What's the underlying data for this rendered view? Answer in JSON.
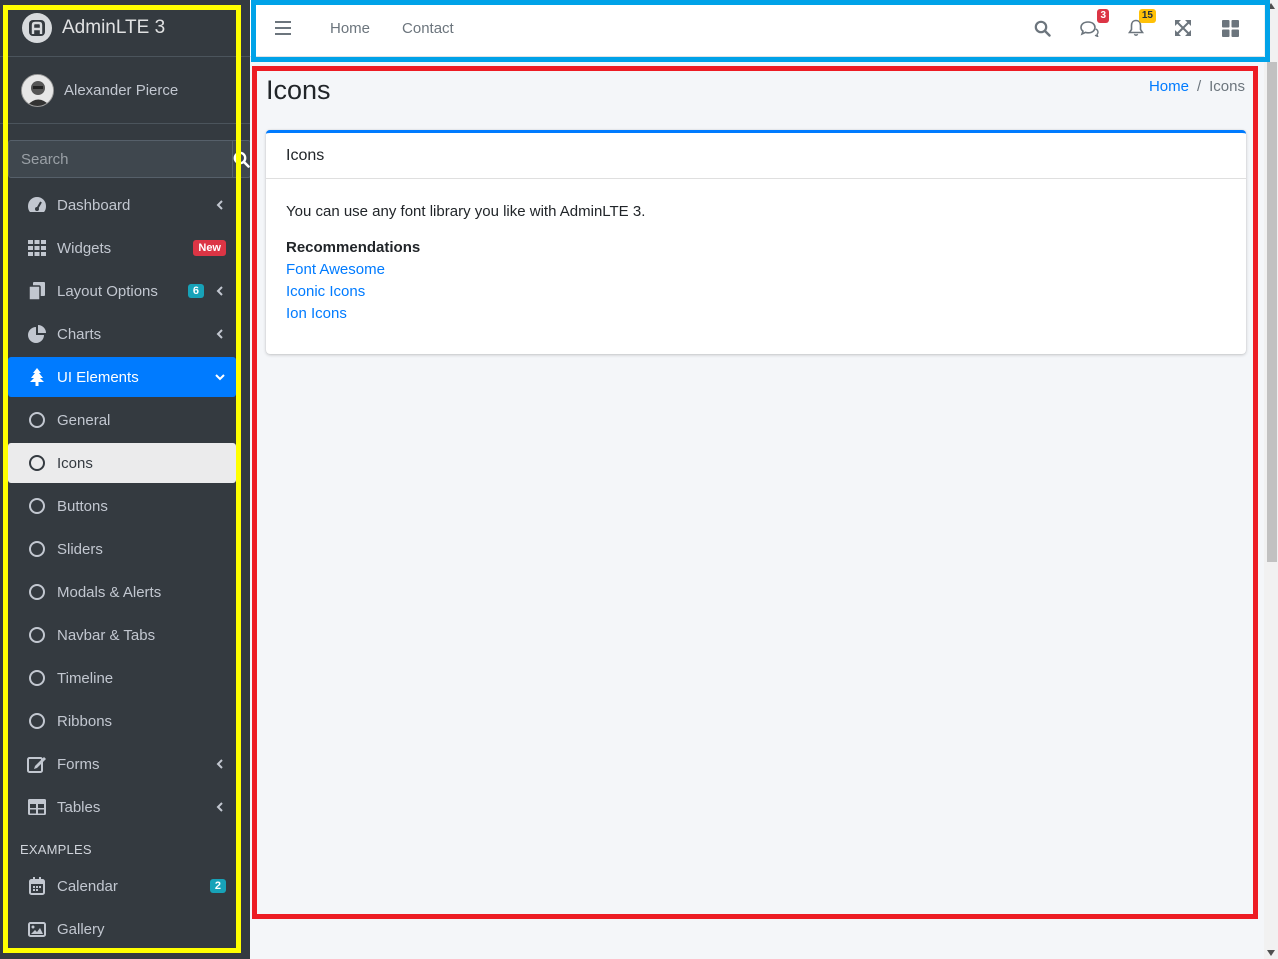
{
  "brand": {
    "name": "AdminLTE 3"
  },
  "user": {
    "name": "Alexander Pierce"
  },
  "search": {
    "placeholder": "Search"
  },
  "sidebar": {
    "items": [
      {
        "label": "Dashboard",
        "icon": "tachometer-icon"
      },
      {
        "label": "Widgets",
        "icon": "th-grid-icon",
        "badge": "New"
      },
      {
        "label": "Layout Options",
        "icon": "copy-icon",
        "badge": "6"
      },
      {
        "label": "Charts",
        "icon": "pie-chart-icon"
      },
      {
        "label": "UI Elements",
        "icon": "tree-icon"
      },
      {
        "label": "General",
        "icon": "circle-icon"
      },
      {
        "label": "Icons",
        "icon": "circle-icon"
      },
      {
        "label": "Buttons",
        "icon": "circle-icon"
      },
      {
        "label": "Sliders",
        "icon": "circle-icon"
      },
      {
        "label": "Modals & Alerts",
        "icon": "circle-icon"
      },
      {
        "label": "Navbar & Tabs",
        "icon": "circle-icon"
      },
      {
        "label": "Timeline",
        "icon": "circle-icon"
      },
      {
        "label": "Ribbons",
        "icon": "circle-icon"
      },
      {
        "label": "Forms",
        "icon": "edit-icon"
      },
      {
        "label": "Tables",
        "icon": "table-icon"
      },
      {
        "label": "Calendar",
        "icon": "calendar-icon",
        "badge": "2"
      },
      {
        "label": "Gallery",
        "icon": "image-icon"
      }
    ],
    "header_examples": "EXAMPLES"
  },
  "navbar": {
    "home": "Home",
    "contact": "Contact",
    "messages_count": "3",
    "notifications_count": "15"
  },
  "content": {
    "title": "Icons",
    "breadcrumb": {
      "home": "Home",
      "current": "Icons"
    },
    "card": {
      "title": "Icons",
      "intro": "You can use any font library you like with AdminLTE 3.",
      "recommendations_label": "Recommendations",
      "links": [
        "Font Awesome",
        "Iconic Icons",
        "Ion Icons"
      ]
    }
  },
  "colors": {
    "sidebar_bg": "#343a40",
    "accent": "#007bff",
    "badge_danger": "#dc3545",
    "badge_info": "#17a2b8",
    "badge_warning": "#ffc107",
    "annotation_yellow": "#ffff00",
    "annotation_blue": "#00a2e8",
    "annotation_red": "#ed1c24"
  }
}
